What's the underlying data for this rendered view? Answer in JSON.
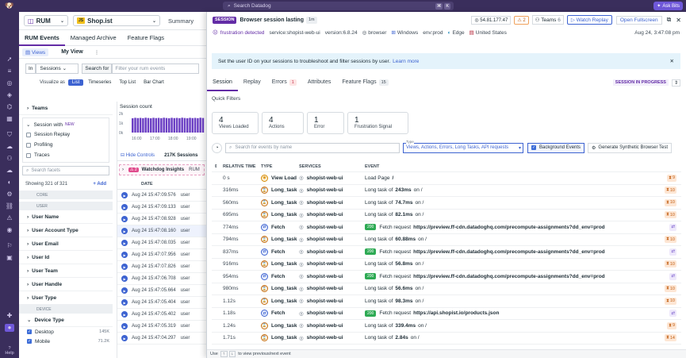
{
  "topbar": {
    "search_placeholder": "Search Datadog",
    "key1": "⌘",
    "key2": "K",
    "ask_label": "Ask Bits"
  },
  "nav": {
    "help_label": "Help"
  },
  "bg": {
    "product": "RUM",
    "app_name": "Shop.ist",
    "summary_tab": "Summary",
    "tabs": [
      "RUM Events",
      "Managed Archive",
      "Feature Flags"
    ],
    "views_label": "Views",
    "myview_label": "My View",
    "in_label": "In",
    "sessions_select": "Sessions",
    "search_for": "Search for",
    "search_placeholder": "Filter your rum events",
    "visualize_as": "Visualize as",
    "viz_options": [
      "List",
      "Timeseries",
      "Top List",
      "Bar Chart"
    ],
    "teams_facet": "Teams",
    "session_with": "Session with",
    "new_badge": "NEW",
    "session_opts": [
      "Session Replay",
      "Profiling",
      "Traces"
    ],
    "search_facets": "Search facets",
    "showing": "Showing 321 of 321",
    "add_label": "Add",
    "core_label": "CORE",
    "user_label": "USER",
    "user_facets": [
      "User Name",
      "User Account Type",
      "User Email",
      "User Id",
      "User Team",
      "User Handle",
      "User Type"
    ],
    "device_label": "DEVICE",
    "device_type": "Device Type",
    "device_values": [
      {
        "name": "Desktop",
        "count": "145K"
      },
      {
        "name": "Mobile",
        "count": "71.2K"
      }
    ],
    "session_count": "Session count",
    "chart_y": [
      "2k",
      "1k",
      "0k"
    ],
    "chart_x": [
      "16:00",
      "17:00",
      "18:00",
      "19:00"
    ],
    "hide_controls": "Hide Controls",
    "sessions_total": "217K Sessions",
    "watchdog": "Watchdog Insights",
    "watchdog_count": "2",
    "rum_label": "RUM",
    "date_header": "DATE",
    "dates": [
      "Aug 24 15:47:09.576",
      "Aug 24 15:47:09.133",
      "Aug 24 15:47:08.928",
      "Aug 24 15:47:08.160",
      "Aug 24 15:47:08.035",
      "Aug 24 15:47:07.956",
      "Aug 24 15:47:07.826",
      "Aug 24 15:47:06.708",
      "Aug 24 15:47:05.664",
      "Aug 24 15:47:05.404",
      "Aug 24 15:47:05.402",
      "Aug 24 15:47:05.319",
      "Aug 24 15:47:04.297"
    ],
    "user_col": "user"
  },
  "chart_data": {
    "type": "bar",
    "title": "Session count",
    "x": [
      "16:00",
      "17:00",
      "18:00",
      "19:00"
    ],
    "values": [
      1500,
      1550,
      1520,
      1540,
      1510,
      1560,
      1530,
      1500,
      1550,
      1520,
      1540,
      1510,
      1560,
      1530,
      1500,
      1550,
      1520,
      1540,
      1510,
      1560,
      1530,
      1500,
      1550,
      1520,
      1540,
      1510,
      1560,
      1530
    ],
    "ylim": [
      0,
      2000
    ],
    "y_ticks": [
      "2k",
      "1k",
      "0k"
    ]
  },
  "panel": {
    "session_tag": "SESSION",
    "title": "Browser session lasting",
    "duration": "1m",
    "ip": "54.81.177.47",
    "warn_count": "2",
    "teams_label": "Teams",
    "teams_count": "6",
    "watch_replay": "Watch Replay",
    "open_fullscreen": "Open Fullscreen",
    "frustration": "frustration detected",
    "service": "service:shopist-web-ui",
    "version": "version:6.8.24",
    "browser": "browser",
    "os": "Windows",
    "env": "env:prod",
    "edge": "Edge",
    "country": "United States",
    "date": "Aug 24, 3:47:08 pm",
    "banner": "Set the user ID on your sessions to troubleshoot and filter sessions by user.",
    "learn_more": "Learn more",
    "tabs": [
      {
        "label": "Session",
        "count": ""
      },
      {
        "label": "Replay",
        "count": ""
      },
      {
        "label": "Errors",
        "count": "1"
      },
      {
        "label": "Attributes",
        "count": ""
      },
      {
        "label": "Feature Flags",
        "count": "15"
      }
    ],
    "status": "SESSION IN PROGRESS",
    "quick_filters": "Quick Filters",
    "cards": [
      {
        "n": "4",
        "l": "Views Loaded"
      },
      {
        "n": "4",
        "l": "Actions"
      },
      {
        "n": "1",
        "l": "Error"
      },
      {
        "n": "1",
        "l": "Frustration Signal"
      }
    ],
    "event_search_placeholder": "Search for events by name",
    "type_label": "Type",
    "type_value": "Views, Actions, Errors, Long Tasks, API requests",
    "bg_events": "Background Events",
    "gen_test": "Generate Synthetic Browser Test",
    "headers": [
      "RELATIVE TIME",
      "TYPE",
      "SERVICES",
      "EVENT"
    ],
    "rows": [
      {
        "time": "0 s",
        "type": "View Load",
        "svc": "shopist-web-ui",
        "pre": "Load Page",
        "bold": "/",
        "post": "",
        "code": "",
        "pill": "9",
        "pc": "o"
      },
      {
        "time": "316ms",
        "type": "Long_task",
        "svc": "shopist-web-ui",
        "pre": "Long task of",
        "bold": "243ms",
        "post": "on /",
        "code": "",
        "pill": "10",
        "pc": "o"
      },
      {
        "time": "560ms",
        "type": "Long_task",
        "svc": "shopist-web-ui",
        "pre": "Long task of",
        "bold": "74.7ms",
        "post": "on /",
        "code": "",
        "pill": "10",
        "pc": "o"
      },
      {
        "time": "695ms",
        "type": "Long_task",
        "svc": "shopist-web-ui",
        "pre": "Long task of",
        "bold": "82.1ms",
        "post": "on /",
        "code": "",
        "pill": "10",
        "pc": "o"
      },
      {
        "time": "774ms",
        "type": "Fetch",
        "svc": "shopist-web-ui",
        "pre": "Fetch request",
        "bold": "https://preview.ff-cdn.datadoghq.com/precompute-assignments?dd_env=prod",
        "post": "",
        "code": "200",
        "pill": "",
        "pc": "p"
      },
      {
        "time": "794ms",
        "type": "Long_task",
        "svc": "shopist-web-ui",
        "pre": "Long task of",
        "bold": "60.88ms",
        "post": "on /",
        "code": "",
        "pill": "10",
        "pc": "o"
      },
      {
        "time": "837ms",
        "type": "Fetch",
        "svc": "shopist-web-ui",
        "pre": "Fetch request",
        "bold": "https://preview.ff-cdn.datadoghq.com/precompute-assignments?dd_env=prod",
        "post": "",
        "code": "200",
        "pill": "",
        "pc": "p"
      },
      {
        "time": "916ms",
        "type": "Long_task",
        "svc": "shopist-web-ui",
        "pre": "Long task of",
        "bold": "56.8ms",
        "post": "on /",
        "code": "",
        "pill": "10",
        "pc": "o"
      },
      {
        "time": "954ms",
        "type": "Fetch",
        "svc": "shopist-web-ui",
        "pre": "Fetch request",
        "bold": "https://preview.ff-cdn.datadoghq.com/precompute-assignments?dd_env=prod",
        "post": "",
        "code": "200",
        "pill": "",
        "pc": "p"
      },
      {
        "time": "980ms",
        "type": "Long_task",
        "svc": "shopist-web-ui",
        "pre": "Long task of",
        "bold": "56.6ms",
        "post": "on /",
        "code": "",
        "pill": "10",
        "pc": "o"
      },
      {
        "time": "1.12s",
        "type": "Long_task",
        "svc": "shopist-web-ui",
        "pre": "Long task of",
        "bold": "98.3ms",
        "post": "on /",
        "code": "",
        "pill": "10",
        "pc": "o"
      },
      {
        "time": "1.18s",
        "type": "Fetch",
        "svc": "shopist-web-ui",
        "pre": "Fetch request",
        "bold": "https://api.shopist.io/products.json",
        "post": "",
        "code": "200",
        "pill": "",
        "pc": "p"
      },
      {
        "time": "1.24s",
        "type": "Long_task",
        "svc": "shopist-web-ui",
        "pre": "Long task of",
        "bold": "339.4ms",
        "post": "on /",
        "code": "",
        "pill": "9",
        "pc": "o"
      },
      {
        "time": "1.71s",
        "type": "Long_task",
        "svc": "shopist-web-ui",
        "pre": "Long task of",
        "bold": "2.84s",
        "post": "on /",
        "code": "",
        "pill": "14",
        "pc": "o"
      }
    ],
    "footer_use": "Use",
    "footer_up": "↑",
    "footer_down": "↓",
    "footer_text": "to view previous/next event"
  }
}
